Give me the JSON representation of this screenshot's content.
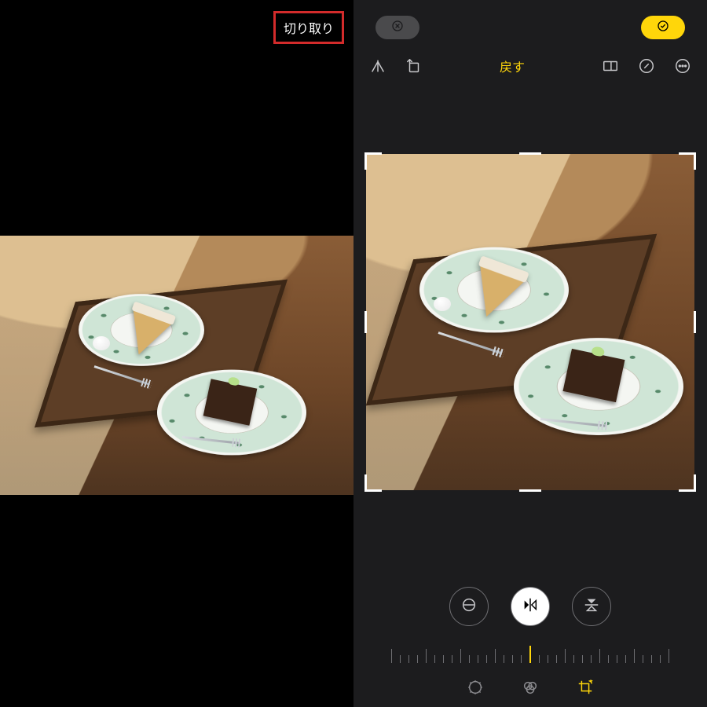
{
  "left": {
    "crop_button_label": "切り取り"
  },
  "right": {
    "cancel_icon": "x-circle-icon",
    "confirm_icon": "check-circle-icon",
    "undo_label": "戻す",
    "toolbar": {
      "flip_icon": "flip-triangle-icon",
      "rotate_icon": "rotate-square-icon",
      "aspect_icon": "aspect-ratio-icon",
      "markup_icon": "pen-circle-icon",
      "more_icon": "ellipsis-circle-icon"
    },
    "adjust": {
      "straighten_icon": "straighten-icon",
      "flip_h_icon": "flip-horizontal-icon",
      "flip_v_icon": "flip-vertical-icon"
    },
    "bottom_tabs": {
      "adjust_icon": "adjust-dial-icon",
      "filters_icon": "filters-icon",
      "crop_icon": "crop-rotate-icon"
    },
    "colors": {
      "accent": "#ffd60a",
      "bg": "#1c1c1e",
      "cancel_pill": "#4a4a4c"
    }
  }
}
